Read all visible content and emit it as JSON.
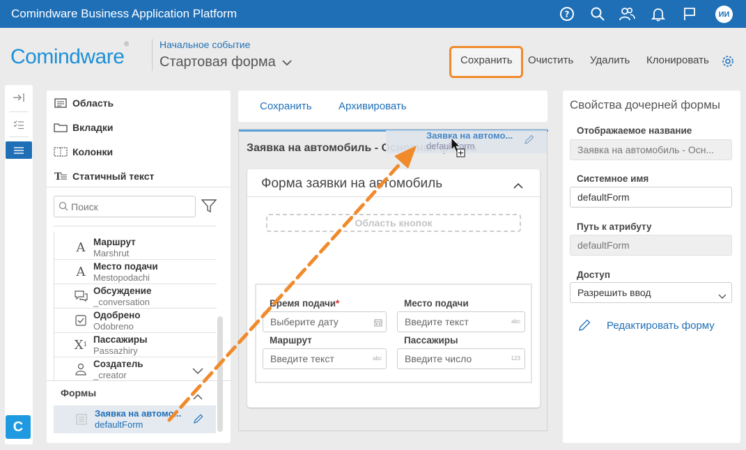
{
  "app_title": "Comindware Business Application Platform",
  "user_initials": "ИИ",
  "topbar_icons": [
    "help-icon",
    "search-icon",
    "users-icon",
    "bell-icon",
    "flag-icon"
  ],
  "header": {
    "logo": "Comindware",
    "logo_mark": "®",
    "subtitle": "Начальное событие",
    "title": "Стартовая форма",
    "buttons": {
      "save": "Сохранить",
      "clear": "Очистить",
      "delete": "Удалить",
      "clone": "Клонировать"
    }
  },
  "components": [
    {
      "label": "Область",
      "icon": "area-icon"
    },
    {
      "label": "Вкладки",
      "icon": "tabs-icon"
    },
    {
      "label": "Колонки",
      "icon": "columns-icon"
    },
    {
      "label": "Статичный текст",
      "icon": "static-text-icon"
    }
  ],
  "search": {
    "placeholder": "Поиск"
  },
  "attributes": [
    {
      "name": "Маршрут",
      "system": "Marshrut",
      "icon": "text-icon"
    },
    {
      "name": "Место подачи",
      "system": "Mestopodachi",
      "icon": "text-icon"
    },
    {
      "name": "Обсуждение",
      "system": "_conversation",
      "icon": "chat-icon"
    },
    {
      "name": "Одобрено",
      "system": "Odobreno",
      "icon": "checkbox-icon"
    },
    {
      "name": "Пассажиры",
      "system": "Passazhiry",
      "icon": "number-icon"
    },
    {
      "name": "Создатель",
      "system": "_creator",
      "icon": "user-icon"
    }
  ],
  "forms_section": {
    "label": "Формы",
    "selected": {
      "name": "Заявка на автомо...",
      "system": "defaultForm"
    }
  },
  "toolbar": {
    "save": "Сохранить",
    "archive": "Архивировать"
  },
  "canvas": {
    "title": "Заявка на автомобиль - Основная форма",
    "drag_ghost": {
      "name": "Заявка на автомо...",
      "system": "defaultForm"
    },
    "form_card_title": "Форма заявки на автомобиль",
    "button_area": "Область кнопок",
    "fields": [
      {
        "label": "Время подачи",
        "required": "*",
        "placeholder": "Выберите дату",
        "suffix": "calendar-icon"
      },
      {
        "label": "Место подачи",
        "required": "",
        "placeholder": "Введите текст",
        "suffix": "abc"
      },
      {
        "label": "Маршрут",
        "required": "",
        "placeholder": "Введите текст",
        "suffix": "abc"
      },
      {
        "label": "Пассажиры",
        "required": "",
        "placeholder": "Введите число",
        "suffix": "123"
      }
    ]
  },
  "properties": {
    "title": "Свойства дочерней формы",
    "display_name_label": "Отображаемое название",
    "display_name_value": "Заявка на автомобиль - Осн...",
    "system_name_label": "Системное имя",
    "system_name_value": "defaultForm",
    "path_label": "Путь к атрибуту",
    "path_value": "defaultForm",
    "access_label": "Доступ",
    "access_value": "Разрешить ввод",
    "edit_form": "Редактировать форму"
  },
  "badge": "C",
  "colors": {
    "primary": "#1f6fb7",
    "highlight": "#f08a2b",
    "logo": "#1d8fd6"
  }
}
